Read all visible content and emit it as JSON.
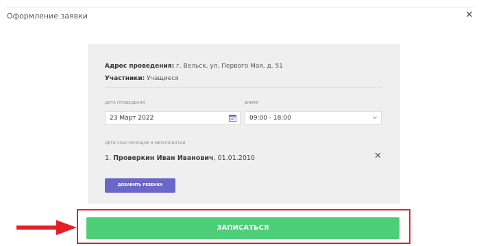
{
  "dialog": {
    "title": "Оформление заявки",
    "close_icon": "close-icon"
  },
  "event": {
    "address_label": "Адрес проведения:",
    "address_value": " г. Вельск, ул. Первого Мая, д. 51",
    "participants_label": "Участники:",
    "participants_value": " Учащиеся"
  },
  "date_field": {
    "label": "ДАТА ПРОВЕДЕНИЯ",
    "value": "23 Март 2022",
    "icon": "calendar-icon"
  },
  "time_field": {
    "label": "ВРЕМЯ",
    "value": "09:00 - 18:00",
    "icon": "chevron-down-icon"
  },
  "children": {
    "label": "ДЕТИ УЧАСТВУЮЩИЕ В МЕРОПРИЯТИИ",
    "items": [
      {
        "number": "1.",
        "name": "Проверкин Иван Иванович",
        "birthdate": ", 01.01.2010"
      }
    ],
    "remove_icon": "remove-icon"
  },
  "add_child_button": "ДОБАВИТЬ РЕБЕНКА",
  "submit_button": "ЗАПИСАТЬСЯ",
  "colors": {
    "submit": "#4fce79",
    "add_button": "#6b67c8",
    "highlight": "#e51e25",
    "card": "#efefef"
  }
}
